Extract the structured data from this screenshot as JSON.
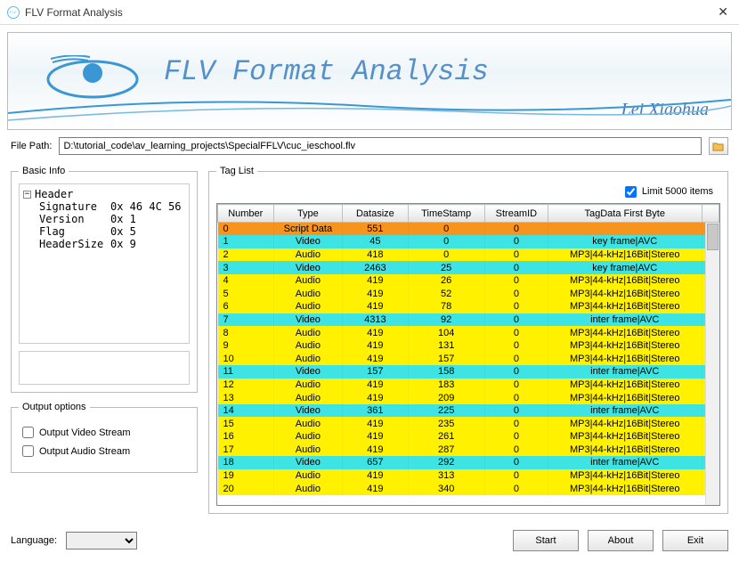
{
  "window": {
    "title": "FLV Format Analysis"
  },
  "banner": {
    "title": "FLV Format Analysis",
    "author": "Lei Xiaohua"
  },
  "filepath": {
    "label": "File Path:",
    "value": "D:\\tutorial_code\\av_learning_projects\\SpecialFFLV\\cuc_ieschool.flv"
  },
  "basicinfo": {
    "legend": "Basic Info",
    "root": "Header",
    "rows": [
      {
        "k": "Signature",
        "v": "0x 46 4C 56"
      },
      {
        "k": "Version",
        "v": "0x 1"
      },
      {
        "k": "Flag",
        "v": "0x 5"
      },
      {
        "k": "HeaderSize",
        "v": "0x 9"
      }
    ]
  },
  "output": {
    "legend": "Output options",
    "video": "Output Video Stream",
    "audio": "Output Audio Stream"
  },
  "taglist": {
    "legend": "Tag List",
    "limit_label": "Limit 5000 items",
    "columns": [
      "Number",
      "Type",
      "Datasize",
      "TimeStamp",
      "StreamID",
      "TagData First Byte",
      ""
    ],
    "rows": [
      {
        "n": 0,
        "t": "Script Data",
        "d": 551,
        "ts": 0,
        "s": 0,
        "fb": "",
        "c": "#f7941d"
      },
      {
        "n": 1,
        "t": "Video",
        "d": 45,
        "ts": 0,
        "s": 0,
        "fb": "key frame|AVC",
        "c": "#3ee3e3"
      },
      {
        "n": 2,
        "t": "Audio",
        "d": 418,
        "ts": 0,
        "s": 0,
        "fb": "MP3|44-kHz|16Bit|Stereo",
        "c": "#fff100"
      },
      {
        "n": 3,
        "t": "Video",
        "d": 2463,
        "ts": 25,
        "s": 0,
        "fb": "key frame|AVC",
        "c": "#3ee3e3"
      },
      {
        "n": 4,
        "t": "Audio",
        "d": 419,
        "ts": 26,
        "s": 0,
        "fb": "MP3|44-kHz|16Bit|Stereo",
        "c": "#fff100"
      },
      {
        "n": 5,
        "t": "Audio",
        "d": 419,
        "ts": 52,
        "s": 0,
        "fb": "MP3|44-kHz|16Bit|Stereo",
        "c": "#fff100"
      },
      {
        "n": 6,
        "t": "Audio",
        "d": 419,
        "ts": 78,
        "s": 0,
        "fb": "MP3|44-kHz|16Bit|Stereo",
        "c": "#fff100"
      },
      {
        "n": 7,
        "t": "Video",
        "d": 4313,
        "ts": 92,
        "s": 0,
        "fb": "inter frame|AVC",
        "c": "#3ee3e3"
      },
      {
        "n": 8,
        "t": "Audio",
        "d": 419,
        "ts": 104,
        "s": 0,
        "fb": "MP3|44-kHz|16Bit|Stereo",
        "c": "#fff100"
      },
      {
        "n": 9,
        "t": "Audio",
        "d": 419,
        "ts": 131,
        "s": 0,
        "fb": "MP3|44-kHz|16Bit|Stereo",
        "c": "#fff100"
      },
      {
        "n": 10,
        "t": "Audio",
        "d": 419,
        "ts": 157,
        "s": 0,
        "fb": "MP3|44-kHz|16Bit|Stereo",
        "c": "#fff100"
      },
      {
        "n": 11,
        "t": "Video",
        "d": 157,
        "ts": 158,
        "s": 0,
        "fb": "inter frame|AVC",
        "c": "#3ee3e3"
      },
      {
        "n": 12,
        "t": "Audio",
        "d": 419,
        "ts": 183,
        "s": 0,
        "fb": "MP3|44-kHz|16Bit|Stereo",
        "c": "#fff100"
      },
      {
        "n": 13,
        "t": "Audio",
        "d": 419,
        "ts": 209,
        "s": 0,
        "fb": "MP3|44-kHz|16Bit|Stereo",
        "c": "#fff100"
      },
      {
        "n": 14,
        "t": "Video",
        "d": 361,
        "ts": 225,
        "s": 0,
        "fb": "inter frame|AVC",
        "c": "#3ee3e3"
      },
      {
        "n": 15,
        "t": "Audio",
        "d": 419,
        "ts": 235,
        "s": 0,
        "fb": "MP3|44-kHz|16Bit|Stereo",
        "c": "#fff100"
      },
      {
        "n": 16,
        "t": "Audio",
        "d": 419,
        "ts": 261,
        "s": 0,
        "fb": "MP3|44-kHz|16Bit|Stereo",
        "c": "#fff100"
      },
      {
        "n": 17,
        "t": "Audio",
        "d": 419,
        "ts": 287,
        "s": 0,
        "fb": "MP3|44-kHz|16Bit|Stereo",
        "c": "#fff100"
      },
      {
        "n": 18,
        "t": "Video",
        "d": 657,
        "ts": 292,
        "s": 0,
        "fb": "inter frame|AVC",
        "c": "#3ee3e3"
      },
      {
        "n": 19,
        "t": "Audio",
        "d": 419,
        "ts": 313,
        "s": 0,
        "fb": "MP3|44-kHz|16Bit|Stereo",
        "c": "#fff100"
      },
      {
        "n": 20,
        "t": "Audio",
        "d": 419,
        "ts": 340,
        "s": 0,
        "fb": "MP3|44-kHz|16Bit|Stereo",
        "c": "#fff100"
      }
    ]
  },
  "bottom": {
    "language": "Language:",
    "start": "Start",
    "about": "About",
    "exit": "Exit"
  }
}
